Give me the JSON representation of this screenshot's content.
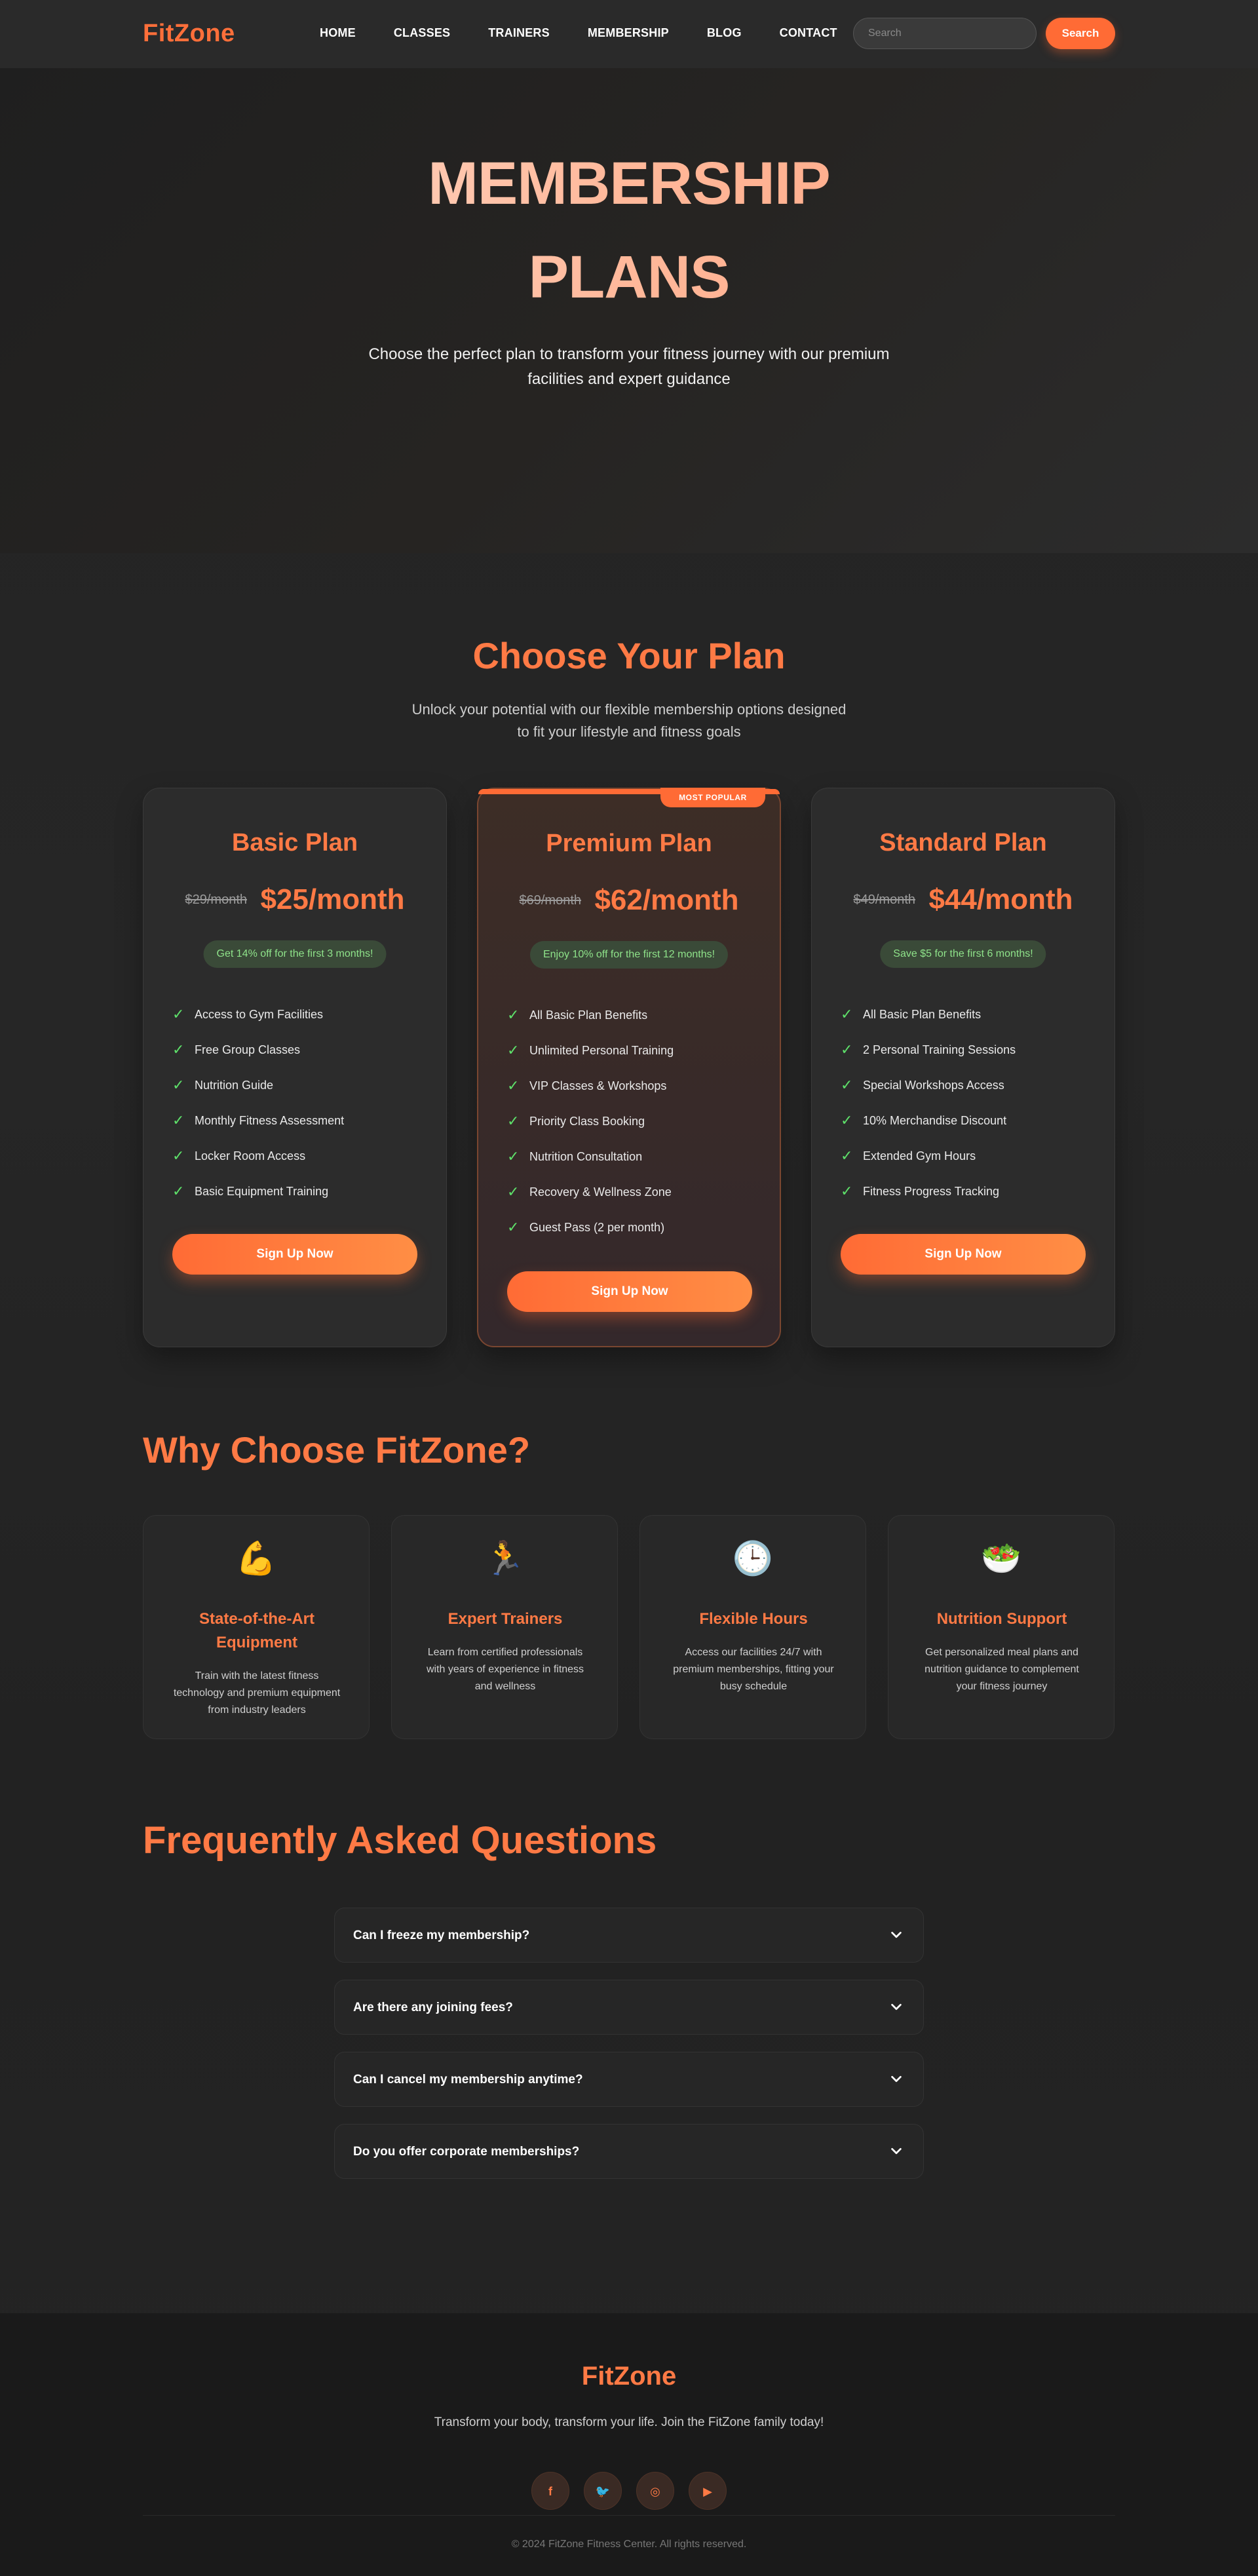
{
  "nav": {
    "logo": "FitZone",
    "items": [
      "HOME",
      "CLASSES",
      "TRAINERS",
      "MEMBERSHIP",
      "BLOG",
      "CONTACT"
    ],
    "search_placeholder": "Search",
    "search_button": "Search"
  },
  "hero": {
    "title_line1": "MEMBERSHIP",
    "title_line2": "PLANS",
    "subtitle_line1": "Choose the perfect plan to transform your fitness journey with our premium",
    "subtitle_line2": "facilities and expert guidance"
  },
  "plans_section": {
    "title": "Choose Your Plan",
    "subtitle_line1": "Unlock your potential with our flexible membership options designed",
    "subtitle_line2": "to fit your lifestyle and fitness goals"
  },
  "plans": [
    {
      "name": "Basic Plan",
      "old_price": "$29/month",
      "price": "$25/month",
      "promo": "Get 14% off for the first 3 months!",
      "features": [
        "Access to Gym Facilities",
        "Free Group Classes",
        "Nutrition Guide",
        "Monthly Fitness Assessment",
        "Locker Room Access",
        "Basic Equipment Training"
      ],
      "cta": "Sign Up Now"
    },
    {
      "name": "Premium Plan",
      "badge": "MOST POPULAR",
      "old_price": "$69/month",
      "price": "$62/month",
      "promo": "Enjoy 10% off for the first 12 months!",
      "features": [
        "All Basic Plan Benefits",
        "Unlimited Personal Training",
        "VIP Classes & Workshops",
        "Priority Class Booking",
        "Nutrition Consultation",
        "Recovery & Wellness Zone",
        "Guest Pass (2 per month)"
      ],
      "cta": "Sign Up Now"
    },
    {
      "name": "Standard Plan",
      "old_price": "$49/month",
      "price": "$44/month",
      "promo": "Save $5 for the first 6 months!",
      "features": [
        "All Basic Plan Benefits",
        "2 Personal Training Sessions",
        "Special Workshops Access",
        "10% Merchandise Discount",
        "Extended Gym Hours",
        "Fitness Progress Tracking"
      ],
      "cta": "Sign Up Now"
    }
  ],
  "why": {
    "title": "Why Choose FitZone?",
    "cards": [
      {
        "icon": "💪",
        "icon_name": "flexed-biceps-icon",
        "title_line1": "State-of-the-Art",
        "title_line2": "Equipment",
        "desc_lines": [
          "Train with the latest fitness",
          "technology and premium equipment",
          "from industry leaders"
        ]
      },
      {
        "icon": "🏃",
        "icon_name": "runner-icon",
        "title_line1": "Expert Trainers",
        "title_line2": "",
        "desc_lines": [
          "Learn from certified professionals",
          "with years of experience in fitness",
          "and wellness"
        ]
      },
      {
        "icon": "🕒",
        "icon_name": "clock-icon",
        "title_line1": "Flexible Hours",
        "title_line2": "",
        "desc_lines": [
          "Access our facilities 24/7 with",
          "premium memberships, fitting your",
          "busy schedule"
        ]
      },
      {
        "icon": "🥗",
        "icon_name": "salad-icon",
        "title_line1": "Nutrition Support",
        "title_line2": "",
        "desc_lines": [
          "Get personalized meal plans and",
          "nutrition guidance to complement",
          "your fitness journey"
        ]
      }
    ]
  },
  "faq": {
    "title": "Frequently Asked Questions",
    "items": [
      "Can I freeze my membership?",
      "Are there any joining fees?",
      "Can I cancel my membership anytime?",
      "Do you offer corporate memberships?"
    ]
  },
  "footer": {
    "logo": "FitZone",
    "tagline": "Transform your body, transform your life. Join the FitZone family today!",
    "socials": [
      {
        "name": "facebook-icon",
        "glyph": "f"
      },
      {
        "name": "twitter-icon",
        "glyph": "🐦"
      },
      {
        "name": "instagram-icon",
        "glyph": "◎"
      },
      {
        "name": "youtube-icon",
        "glyph": "▶"
      }
    ],
    "copyright": "© 2024 FitZone Fitness Center. All rights reserved."
  },
  "colors": {
    "accent": "#ff6b35",
    "accent_text": "#ff7a45",
    "promo_text": "#8fe38a",
    "check": "#5ee06a",
    "background": "#232323",
    "footer_bg": "#1a1a1a"
  }
}
